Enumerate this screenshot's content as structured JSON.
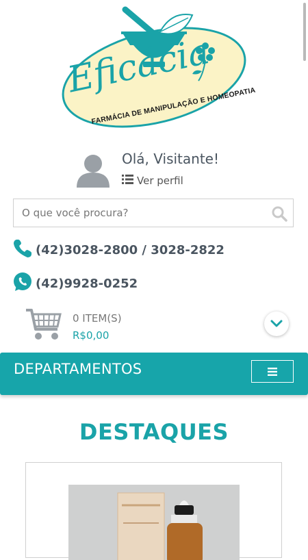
{
  "brand": {
    "logo_name": "Eficácia",
    "tagline": "FARMÁCIA DE MANIPULAÇÃO E HOMEOPATIA",
    "colors": {
      "teal": "#1aa3a8",
      "cream": "#fbf3c6",
      "dark": "#4a5560"
    }
  },
  "user": {
    "greeting": "Olá, Visitante!",
    "profile_link": "Ver perfil",
    "avatar_icon": "user-avatar-icon",
    "list_icon": "list-icon"
  },
  "search": {
    "placeholder": "O que você procura?",
    "icon": "search-icon"
  },
  "contacts": {
    "phone": "(42)3028-2800 / 3028-2822",
    "whatsapp": "(42)9928-0252",
    "phone_icon": "phone-icon",
    "whatsapp_icon": "whatsapp-icon"
  },
  "cart": {
    "items": "0 ITEM(S)",
    "total": "R$0,00",
    "icon": "shopping-cart-icon",
    "toggle_icon": "chevron-down-icon"
  },
  "departments": {
    "label": "DEPARTAMENTOS",
    "toggle_icon": "hamburger-menu-icon"
  },
  "highlights": {
    "title": "DESTAQUES"
  }
}
